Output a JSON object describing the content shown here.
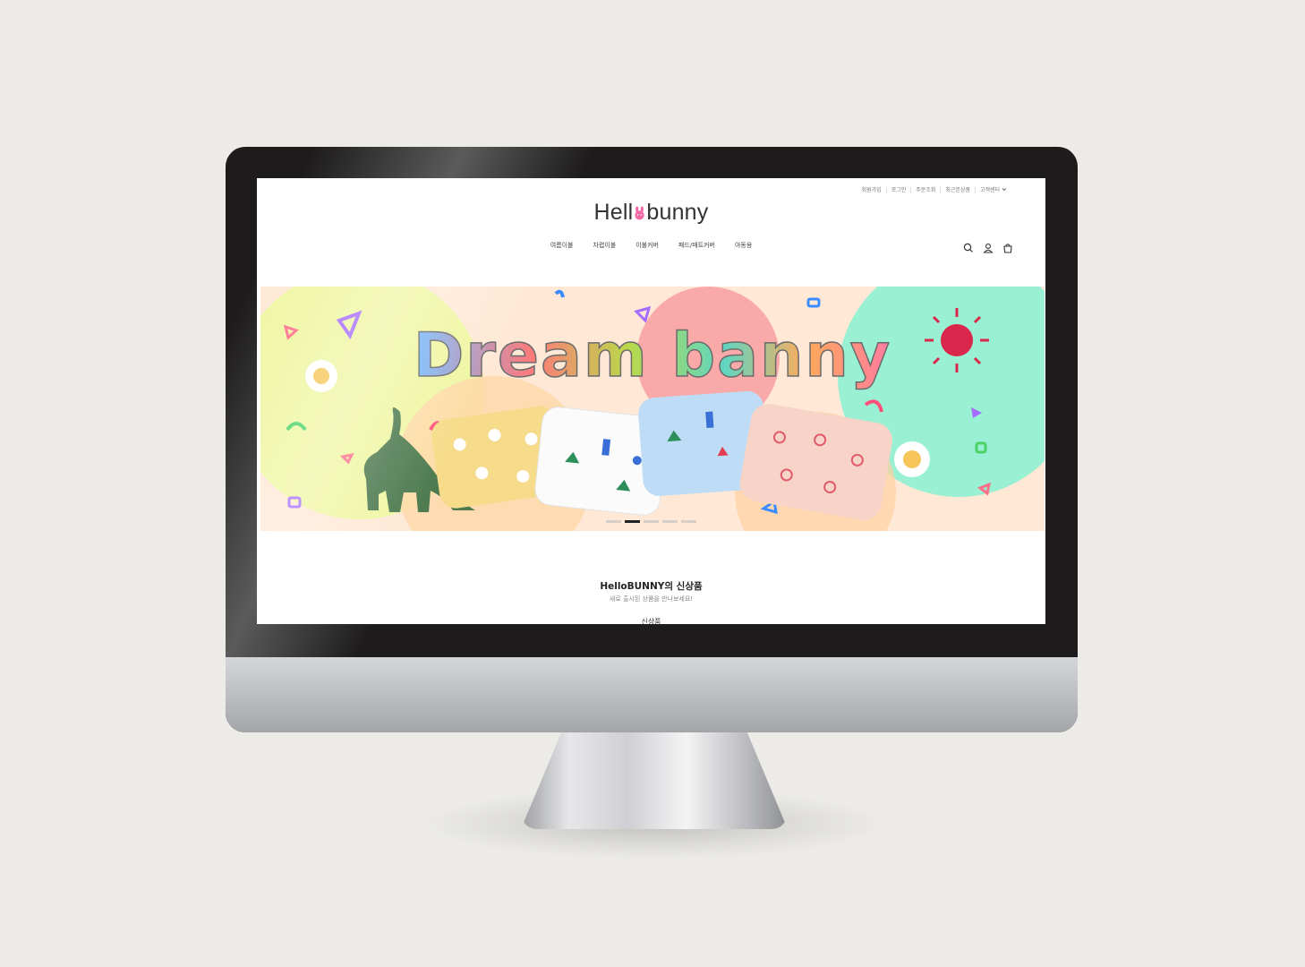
{
  "util_links": [
    "회원가입",
    "로그인",
    "주문조회",
    "최근본상품",
    "고객센터"
  ],
  "logo": {
    "prefix": "Hell",
    "suffix": "bunny"
  },
  "nav": [
    "여름이불",
    "차렵이불",
    "이불커버",
    "패드/매트커버",
    "아동용"
  ],
  "icons": [
    "search-icon",
    "user-icon",
    "cart-icon",
    "chevron-down-icon"
  ],
  "banner": {
    "headline": "Dream banny",
    "slides_total": 5,
    "active_slide": 2,
    "colors": {
      "yellow": "#e8f59a",
      "mint": "#8ff0cf",
      "pink": "#f7a6a8",
      "peach": "#ffd6b0"
    }
  },
  "section": {
    "title": "HelloBUNNY의 신상품",
    "subtitle": "새로 출시된 상품을 만나보세요!",
    "tab": "신상품"
  }
}
